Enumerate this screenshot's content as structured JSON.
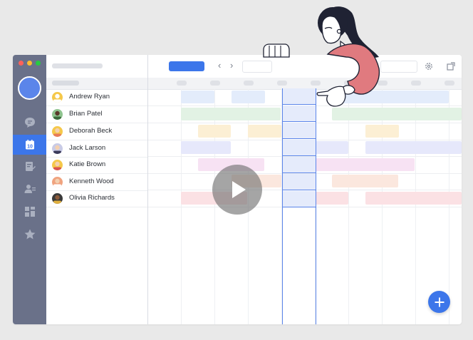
{
  "app": {
    "window_controls": [
      "close",
      "minimize",
      "maximize"
    ],
    "colors": {
      "sidebar": "#6a7189",
      "accent": "#3c76ea",
      "close": "#ff6159",
      "minimize": "#ffbd2e",
      "maximize": "#28c941"
    }
  },
  "sidebar": {
    "items": [
      {
        "icon": "chat-icon"
      },
      {
        "icon": "calendar-icon",
        "label": "10",
        "active": true
      },
      {
        "icon": "document-edit-icon"
      },
      {
        "icon": "user-settings-icon"
      },
      {
        "icon": "dashboard-icon"
      },
      {
        "icon": "star-icon"
      }
    ]
  },
  "people": [
    {
      "name": "Andrew Ryan",
      "avatar_color": "#f5c84a"
    },
    {
      "name": "Brian Patel",
      "avatar_color": "#8fc48f"
    },
    {
      "name": "Deborah Beck",
      "avatar_color": "#f5c84a"
    },
    {
      "name": "Jack Larson",
      "avatar_color": "#c9cbe6"
    },
    {
      "name": "Katie Brown",
      "avatar_color": "#f5c84a"
    },
    {
      "name": "Kenneth Wood",
      "avatar_color": "#f0a37f"
    },
    {
      "name": "Olivia Richards",
      "avatar_color": "#3a3a3a"
    }
  ],
  "toolbar": {
    "nav_prev": "‹",
    "nav_next": "›",
    "icons": [
      "gear-icon",
      "export-icon"
    ]
  },
  "fab": {
    "label": "+"
  },
  "video": {
    "control": "play-icon"
  }
}
